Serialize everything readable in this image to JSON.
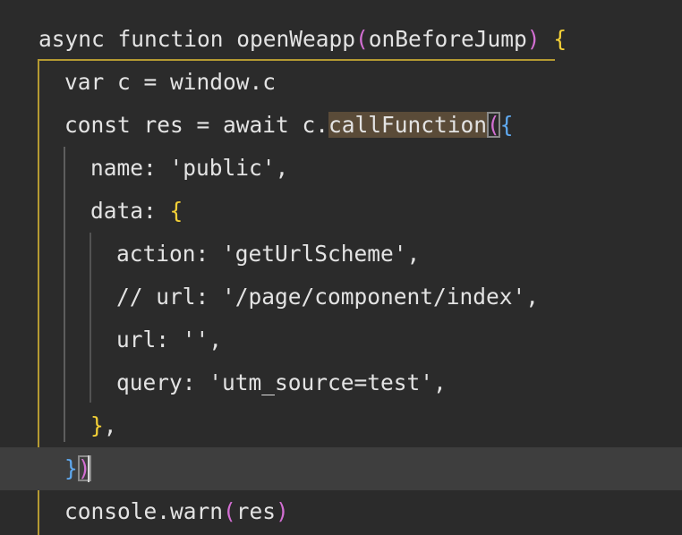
{
  "editor": {
    "background": "#2b2b2b",
    "text_color": "#e3e3e3",
    "current_line_background": "#3e3e3e",
    "bracket_colors": {
      "level1": "#f3d037",
      "level2": "#d36fd3",
      "level3": "#5fa9f0"
    },
    "highlighted_word": "callFunction",
    "current_line_number": 11
  },
  "code": {
    "l1": {
      "a": "async function openWeapp",
      "b": "(",
      "c": "onBeforeJump",
      "d": ")",
      "e": " ",
      "f": "{"
    },
    "l2": {
      "a": "var c = window.c"
    },
    "l3": {
      "a": "const res = await c.",
      "b": "callFunction",
      "c": "(",
      "d": "{"
    },
    "l4": {
      "a": "name: 'public',"
    },
    "l5": {
      "a": "data: ",
      "b": "{"
    },
    "l6": {
      "a": "action: 'getUrlScheme',"
    },
    "l7": {
      "a": "// url: '/page/component/index',"
    },
    "l8": {
      "a": "url: '',"
    },
    "l9": {
      "a": "query: 'utm_source=test',"
    },
    "l10": {
      "a": "}",
      "b": ","
    },
    "l11": {
      "a": "}",
      "b": ")"
    },
    "l12": {
      "a": "console.warn",
      "b": "(",
      "c": "res",
      "d": ")"
    }
  }
}
